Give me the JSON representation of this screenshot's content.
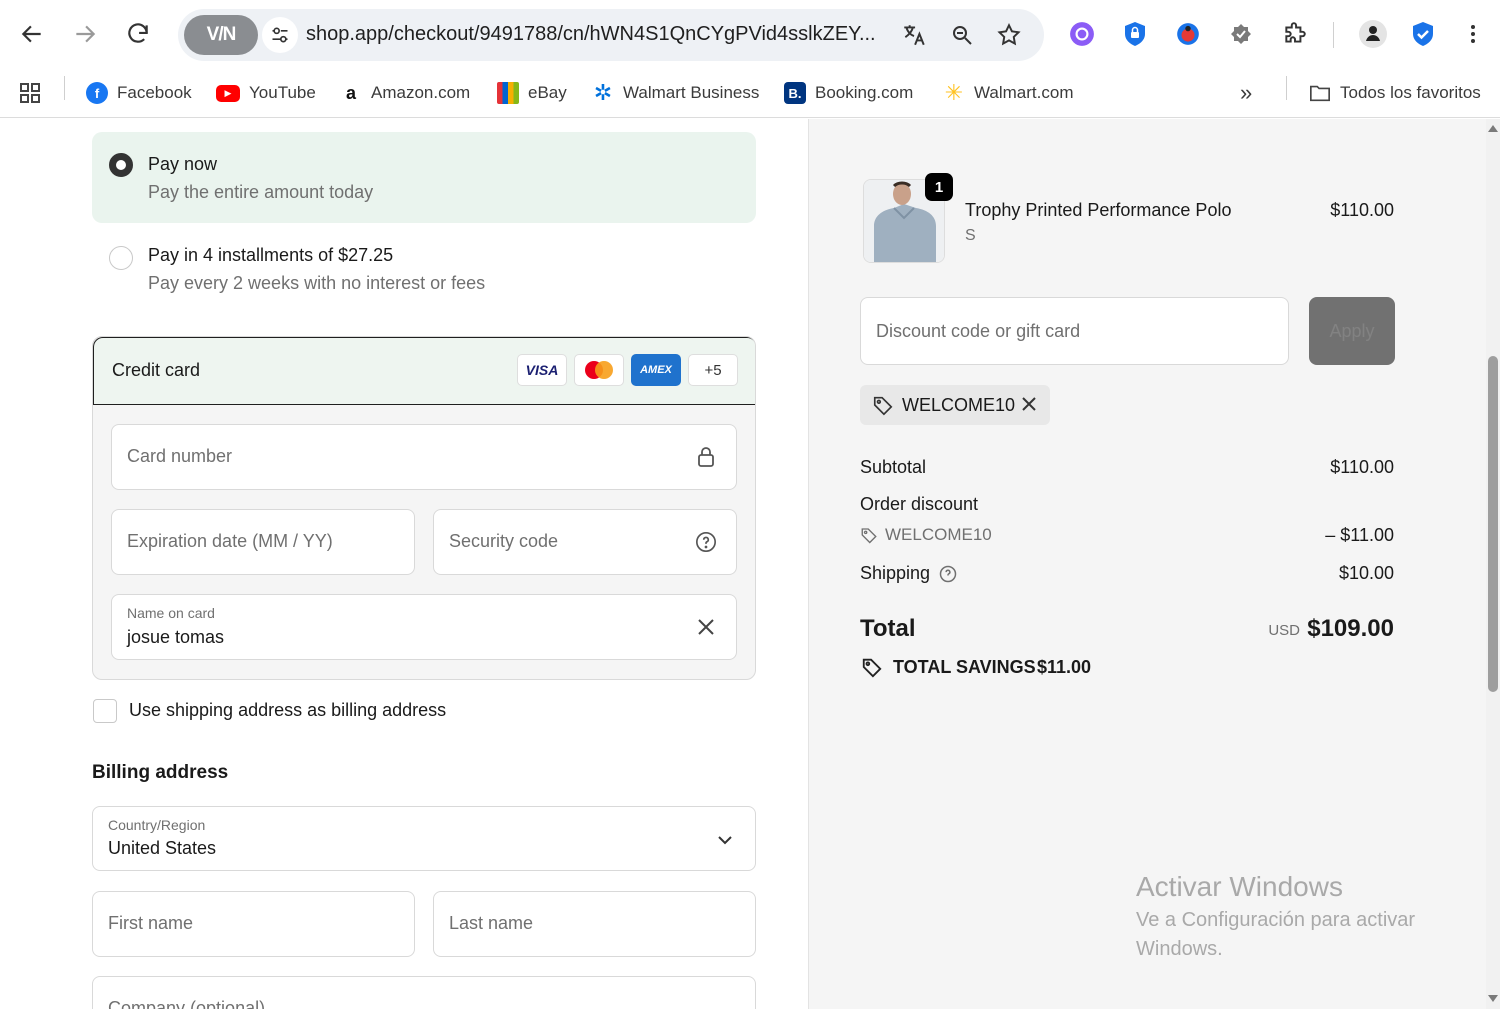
{
  "browser": {
    "url": "shop.app/checkout/9491788/cn/hWN4S1QnCYgPVid4sslkZEY...",
    "vpn_label": "V/N",
    "bookmarks": [
      {
        "label": "Facebook",
        "icon": "facebook-icon",
        "color": "#1877f2"
      },
      {
        "label": "YouTube",
        "icon": "youtube-icon",
        "color": "#ff0000"
      },
      {
        "label": "Amazon.com",
        "icon": "amazon-icon",
        "color": "#222222"
      },
      {
        "label": "eBay",
        "icon": "ebay-icon",
        "color": "#e53238"
      },
      {
        "label": "Walmart Business",
        "icon": "walmart-business-icon",
        "color": "#0071dc"
      },
      {
        "label": "Booking.com",
        "icon": "booking-icon",
        "color": "#003580"
      },
      {
        "label": "Walmart.com",
        "icon": "walmart-icon",
        "color": "#ffc220"
      }
    ],
    "all_bookmarks_label": "Todos los favoritos"
  },
  "payment_options": {
    "pay_now_title": "Pay now",
    "pay_now_sub": "Pay the entire amount today",
    "installments_title": "Pay in 4 installments of $27.25",
    "installments_sub": "Pay every 2 weeks with no interest or fees",
    "selected": "pay_now"
  },
  "credit_card": {
    "title": "Credit card",
    "logos": [
      "VISA",
      "Mastercard",
      "AMEX",
      "+5"
    ],
    "card_number_placeholder": "Card number",
    "expiration_placeholder": "Expiration date (MM / YY)",
    "security_placeholder": "Security code",
    "name_label": "Name on card",
    "name_value": "josue tomas"
  },
  "billing": {
    "use_shipping_label": "Use shipping address as billing address",
    "heading": "Billing address",
    "country_label": "Country/Region",
    "country_value": "United States",
    "first_name_placeholder": "First name",
    "last_name_placeholder": "Last name",
    "company_placeholder": "Company (optional)"
  },
  "summary": {
    "item_name": "Trophy Printed Performance Polo",
    "item_variant": "S",
    "item_price": "$110.00",
    "item_qty": "1",
    "discount_placeholder": "Discount code or gift card",
    "apply_label": "Apply",
    "applied_code": "WELCOME10",
    "subtotal_label": "Subtotal",
    "subtotal_value": "$110.00",
    "order_discount_label": "Order discount",
    "discount_code": "WELCOME10",
    "discount_value": "– $11.00",
    "shipping_label": "Shipping",
    "shipping_value": "$10.00",
    "total_label": "Total",
    "currency": "USD",
    "total_value": "$109.00",
    "savings_label": "TOTAL SAVINGS",
    "savings_value": "$11.00"
  },
  "watermark": {
    "title": "Activar Windows",
    "line1": "Ve a Configuración para activar",
    "line2": "Windows."
  }
}
